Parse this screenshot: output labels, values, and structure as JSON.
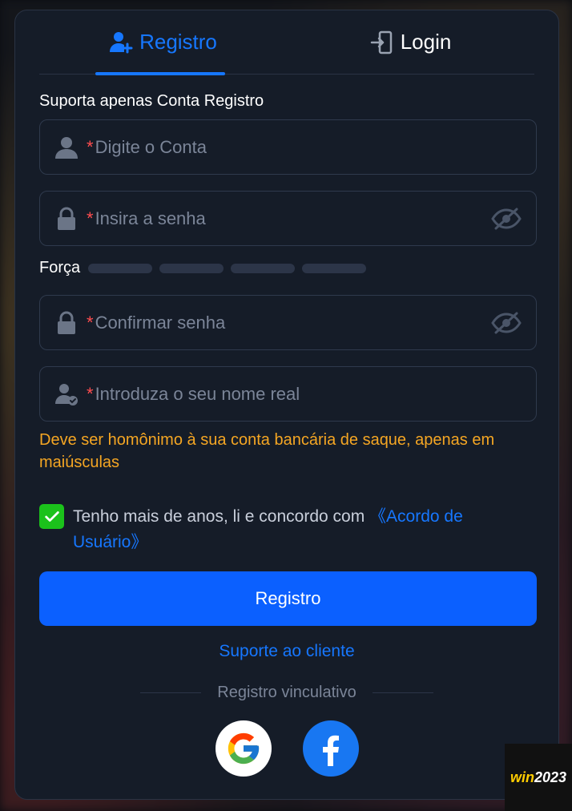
{
  "tabs": [
    {
      "label": "Registro",
      "icon": "user-plus-icon",
      "active": true
    },
    {
      "label": "Login",
      "icon": "door-enter-icon",
      "active": false
    }
  ],
  "subtitle": "Suporta apenas Conta Registro",
  "fields": {
    "account": {
      "required_mark": "*",
      "placeholder": "Digite o Conta",
      "value": "",
      "icon": "user-icon"
    },
    "password": {
      "required_mark": "*",
      "placeholder": "Insira a senha",
      "value": "",
      "icon": "lock-icon"
    },
    "confirm": {
      "required_mark": "*",
      "placeholder": "Confirmar senha",
      "value": "",
      "icon": "lock-icon"
    },
    "real_name": {
      "required_mark": "*",
      "placeholder": "Introduza o seu nome real",
      "value": "",
      "icon": "user-check-icon"
    }
  },
  "strength": {
    "label": "Força",
    "level": 0,
    "segments": 4
  },
  "hint": "Deve ser homônimo à sua conta bancária de saque, apenas em maiúsculas",
  "agreement": {
    "checked": true,
    "text": "Tenho mais de anos, li e concordo com ",
    "link": "《Acordo de Usuário》"
  },
  "submit_label": "Registro",
  "support_link": "Suporte ao cliente",
  "bind_label": "Registro vinculativo",
  "badge": {
    "part1": "win",
    "part2": "2023"
  },
  "colors": {
    "accent": "#1677ff",
    "button": "#0b60ff",
    "warning": "#f5a623",
    "required": "#ff4d4f",
    "checkbox": "#1bc21b",
    "panel": "#151c28"
  }
}
